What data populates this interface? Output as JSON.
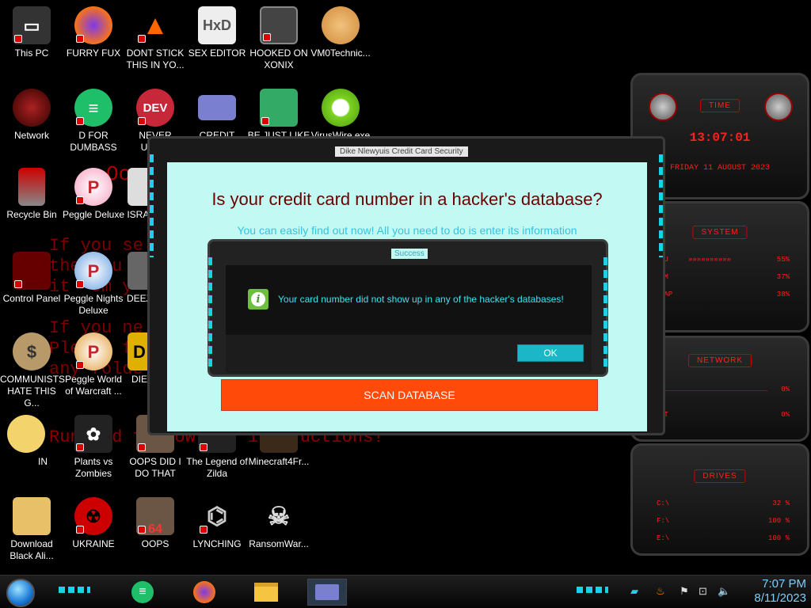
{
  "desktop_icons": [
    {
      "label": "This PC",
      "icon": "computer-icon"
    },
    {
      "label": "FURRY FUX",
      "icon": "firefox-icon"
    },
    {
      "label": "DONT STICK THIS IN YO...",
      "icon": "vlc-cone-icon"
    },
    {
      "label": "SEX EDITOR",
      "icon": "hex-editor-icon"
    },
    {
      "label": "HOOKED ON XONIX",
      "icon": "xonix-icon"
    },
    {
      "label": "VM0Technic...",
      "icon": "doctor-icon"
    },
    {
      "label": "Network",
      "icon": "network-icon"
    },
    {
      "label": "D FOR DUMBASS",
      "icon": "green-chat-icon"
    },
    {
      "label": "NEVER USED!",
      "icon": "devcpp-icon"
    },
    {
      "label": "CREDIT CARD",
      "icon": "credit-card-icon"
    },
    {
      "label": "BE JUST LIKE",
      "icon": "santa-elf-icon"
    },
    {
      "label": "VirusWire.exe",
      "icon": "lime-icon"
    },
    {
      "label": "Recycle Bin",
      "icon": "recycle-bin-icon"
    },
    {
      "label": "Peggle Deluxe",
      "icon": "peggle-icon"
    },
    {
      "label": "ISRAI",
      "icon": "israel-icon"
    },
    {
      "label": "Control Panel",
      "icon": "control-panel-icon"
    },
    {
      "label": "Peggle Nights Deluxe",
      "icon": "peggle-nights-icon"
    },
    {
      "label": "DEEZ",
      "icon": "printer-icon"
    },
    {
      "label": "COMMUNISTS HATE THIS G...",
      "icon": "money-bag-icon"
    },
    {
      "label": "Peggle World of Warcraft ...",
      "icon": "peggle-wow-icon"
    },
    {
      "label": "DIE",
      "icon": "die-icon"
    },
    {
      "label": "IN",
      "icon": "star-cartoon-icon"
    },
    {
      "label": "Plants vs Zombies",
      "icon": "flower-icon"
    },
    {
      "label": "OOPS DID I DO THAT",
      "icon": "portrait-icon"
    },
    {
      "label": "The Legend of Zilda",
      "icon": "zelda-icon"
    },
    {
      "label": "Minecraft4Fr...",
      "icon": "minecraft-icon"
    },
    {
      "label": "Download Black Ali...",
      "icon": "cartoon-girl-icon"
    },
    {
      "label": "UKRAINE",
      "icon": "radiation-icon"
    },
    {
      "label": "OOPS",
      "icon": "portrait-64-icon"
    },
    {
      "label": "LYNCHING",
      "icon": "knot-icon"
    },
    {
      "label": "RansomWar...",
      "icon": "skull-icon"
    }
  ],
  "background_text": {
    "oooo": "Oooo",
    "lines": "If you se\nthe you\nit  om y\n\nIf you ne\nPlease f\nany folde",
    "run": "Run and follow the instructions!"
  },
  "gadgets": {
    "time": {
      "title": "TIME",
      "clock": "13:07:01",
      "date": "FRIDAY 11 AUGUST 2023"
    },
    "system": {
      "title": "SYSTEM",
      "rows": [
        {
          "label": "PU",
          "value": "55%"
        },
        {
          "label": "AM",
          "value": "37%"
        },
        {
          "label": "WAP",
          "value": "38%"
        }
      ]
    },
    "network": {
      "title": "NETWORK",
      "rows": [
        {
          "label": "",
          "value": "0%"
        },
        {
          "label": "UT",
          "value": "0%"
        }
      ]
    },
    "drives": {
      "title": "DRIVES",
      "rows": [
        {
          "label": "C:\\",
          "value": "32 %"
        },
        {
          "label": "F:\\",
          "value": "100 %"
        },
        {
          "label": "E:\\",
          "value": "100 %"
        }
      ]
    }
  },
  "main_window": {
    "title": "Dike Nlewyuis Credit Card Security",
    "heading": "Is your credit card number in a hacker's database?",
    "subheading": "You can easily find out now! All you need to do is enter its information",
    "scan_button": "SCAN DATABASE"
  },
  "dialog": {
    "title": "Success",
    "message": "Your card number did not show up in any of the hacker's databases!",
    "ok_button": "OK"
  },
  "taskbar": {
    "clock_time": "7:07 PM",
    "clock_date": "8/11/2023"
  }
}
